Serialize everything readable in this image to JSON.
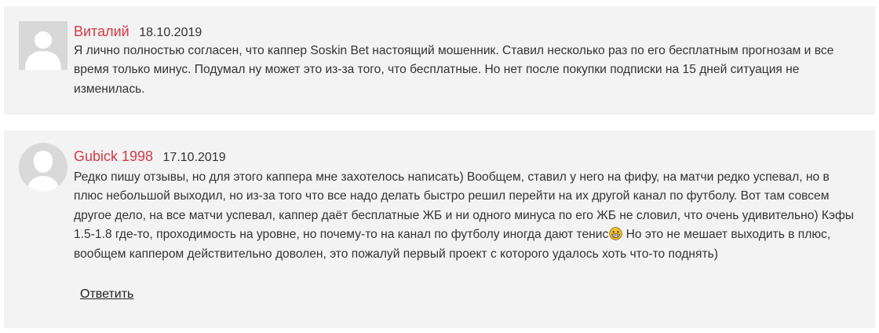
{
  "comments": [
    {
      "author": "Виталий",
      "date": "18.10.2019",
      "avatar_icon": "default-avatar-icon",
      "text": "Я лично полностью согласен, что каппер Soskin Bet настоящий мошенник. Ставил несколько раз по его бесплатным прогнозам и все время только минус. Подумал ну может это из-за того, что бесплатные. Но нет после покупки подписки на 15 дней ситуация не изменилась."
    },
    {
      "author": "Gubick 1998",
      "date": "17.10.2019",
      "avatar_icon": "user-silhouette-icon",
      "text_before_emoji": "Редко пишу отзывы, но для этого каппера мне захотелось написать) Вообщем, ставил у него на фифу, на матчи редко успевал, но в плюс небольшой выходил, но из-за того что все надо делать быстро решил перейти на их другой канал по футболу. Вот там совсем другое дело, на все матчи успевал, каппер даёт бесплатные ЖБ и ни одного минуса по его ЖБ не словил, что очень удивительно) Кэфы 1.5-1.8 где-то, проходимость на уровне, но почему-то на канал по футболу иногда дают тенис",
      "emoji_icon": "grinning-face-emoji-icon",
      "text_after_emoji": " Но это не мешает выходить в плюс, вообщем каппером действительно доволен, это пожалуй первый проект с которого удалось хоть что-то поднять)",
      "reply_label": "Ответить"
    }
  ],
  "colors": {
    "author": "#d03b47",
    "card_background": "#f3f3f3",
    "text": "#333333"
  }
}
